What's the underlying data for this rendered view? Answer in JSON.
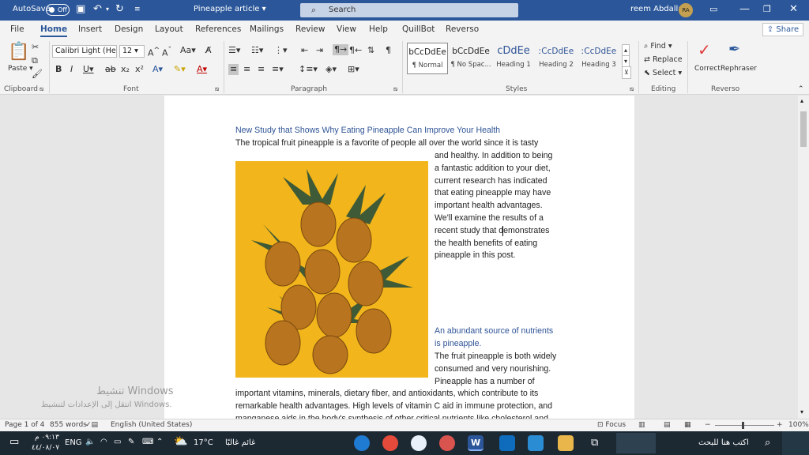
{
  "titlebar": {
    "autosave_label": "AutoSave",
    "autosave_state": "Off",
    "doc_title": "Pineapple article",
    "search_placeholder": "Search",
    "user_name": "reem Abdalla",
    "user_initials": "RA"
  },
  "tabs": [
    "File",
    "Home",
    "Insert",
    "Design",
    "Layout",
    "References",
    "Mailings",
    "Review",
    "View",
    "Help",
    "QuillBot",
    "Reverso"
  ],
  "share_label": "Share",
  "ribbon": {
    "clipboard": {
      "paste": "Paste",
      "label": "Clipboard"
    },
    "font": {
      "name": "Calibri Light (Hea",
      "size": "12",
      "label": "Font"
    },
    "paragraph_label": "Paragraph",
    "styles": {
      "label": "Styles",
      "items": [
        {
          "preview": "bCcDdEe",
          "name": "¶ Normal"
        },
        {
          "preview": "bCcDdEe",
          "name": "¶ No Spac..."
        },
        {
          "preview": "cDdEe",
          "name": "Heading 1"
        },
        {
          "preview": "ːCcDdEe",
          "name": "Heading 2"
        },
        {
          "preview": "ːCcDdEe",
          "name": "Heading 3"
        }
      ]
    },
    "editing": {
      "find": "Find",
      "replace": "Replace",
      "select": "Select",
      "label": "Editing"
    },
    "reverso": {
      "correct": "Correct",
      "rephraser": "Rephraser",
      "label": "Reverso"
    }
  },
  "document": {
    "heading": "New Study that Shows Why Eating Pineapple Can Improve Your Health",
    "line1": "The tropical fruit pineapple is a favorite of people all over the world since it is tasty",
    "wrap_lines": [
      "and healthy. In addition to being",
      "a fantastic addition to your diet,",
      "current research has indicated",
      "that eating pineapple may have",
      "important health advantages.",
      "We'll examine the results of a",
      "recent study that demonstrates",
      "the health benefits of eating",
      "pineapple in this post."
    ],
    "subheading_lines": [
      "An abundant source of nutrients",
      "is pineapple."
    ],
    "para2_wrap": [
      "The fruit pineapple is both widely",
      "consumed and very nourishing.",
      "Pineapple has a number of"
    ],
    "full_lines": [
      "important vitamins, minerals, dietary fiber, and antioxidants, which contribute to its",
      "remarkable health advantages. High levels of vitamin C aid in immune protection, and",
      "manganese aids in the body's synthesis of other critical nutrients like cholesterol and"
    ]
  },
  "watermark": {
    "title": "تنشيط Windows",
    "subtitle": "انتقل إلى الإعدادات لتنشيط Windows."
  },
  "statusbar": {
    "page": "Page 1 of 4",
    "words": "855 words",
    "language": "English (United States)",
    "focus": "Focus",
    "zoom": "100%"
  },
  "taskbar": {
    "time": "٠٩:١٣ م",
    "date": "٤٤/٠٨/٠٧",
    "lang": "ENG",
    "weather_temp": "17°C",
    "weather_desc": "غائم غالبًا",
    "search_placeholder": "اكتب هنا للبحث"
  },
  "colors": {
    "accent": "#2b579a",
    "heading": "#2f5496",
    "pineapple_bg": "#f2b51b"
  }
}
